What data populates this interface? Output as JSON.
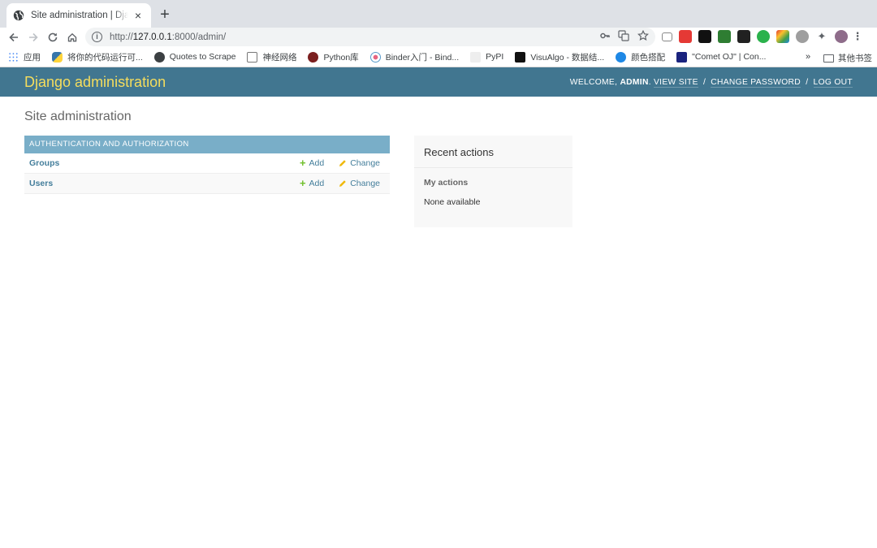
{
  "browser": {
    "tab_title": "Site administration | Django site admin",
    "tab_close": "×",
    "new_tab": "+",
    "url_prefix": "http://",
    "url_host": "127.0.0.1",
    "url_rest": ":8000/admin/"
  },
  "bookmarks": {
    "items": [
      {
        "label": "应用",
        "icon": "apps-grid-icon",
        "color": "#4285f4"
      },
      {
        "label": "将你的代码运行可...",
        "icon": "python-icon",
        "color": "#3776ab"
      },
      {
        "label": "Quotes to Scrape",
        "icon": "globe-icon",
        "color": "#5f6368"
      },
      {
        "label": "神经网络",
        "icon": "image-icon",
        "color": "#9e9e9e"
      },
      {
        "label": "Python库",
        "icon": "python-lib-icon",
        "color": "#b71c1c"
      },
      {
        "label": "Binder入门 - Bind...",
        "icon": "binder-icon",
        "color": "#e66581"
      },
      {
        "label": "PyPI",
        "icon": "pypi-icon",
        "color": "#e0e0e0"
      },
      {
        "label": "VisuAlgo - 数据结...",
        "icon": "visualgo-icon",
        "color": "#111111"
      },
      {
        "label": "颜色搭配",
        "icon": "color-icon",
        "color": "#1e88e5"
      },
      {
        "label": "\"Comet OJ\" | Con...",
        "icon": "cometoj-icon",
        "color": "#1a237e"
      }
    ],
    "more": "»",
    "other": "其他书签"
  },
  "admin": {
    "branding": "Django administration",
    "welcome": "Welcome,",
    "username": "admin",
    "view_site": "View site",
    "change_password": "Change password",
    "log_out": "Log out",
    "sep": "/",
    "page_title": "Site administration",
    "app_caption": "Authentication and Authorization",
    "models": [
      {
        "name": "Groups",
        "add": "Add",
        "change": "Change"
      },
      {
        "name": "Users",
        "add": "Add",
        "change": "Change"
      }
    ],
    "recent_title": "Recent actions",
    "my_actions": "My actions",
    "none_available": "None available"
  },
  "colors": {
    "header_bg": "#417690",
    "branding": "#f5dd5d",
    "caption_bg": "#79aec8",
    "link": "#447e9b",
    "add_green": "#70bf2b",
    "change_yellow": "#efb80b"
  }
}
